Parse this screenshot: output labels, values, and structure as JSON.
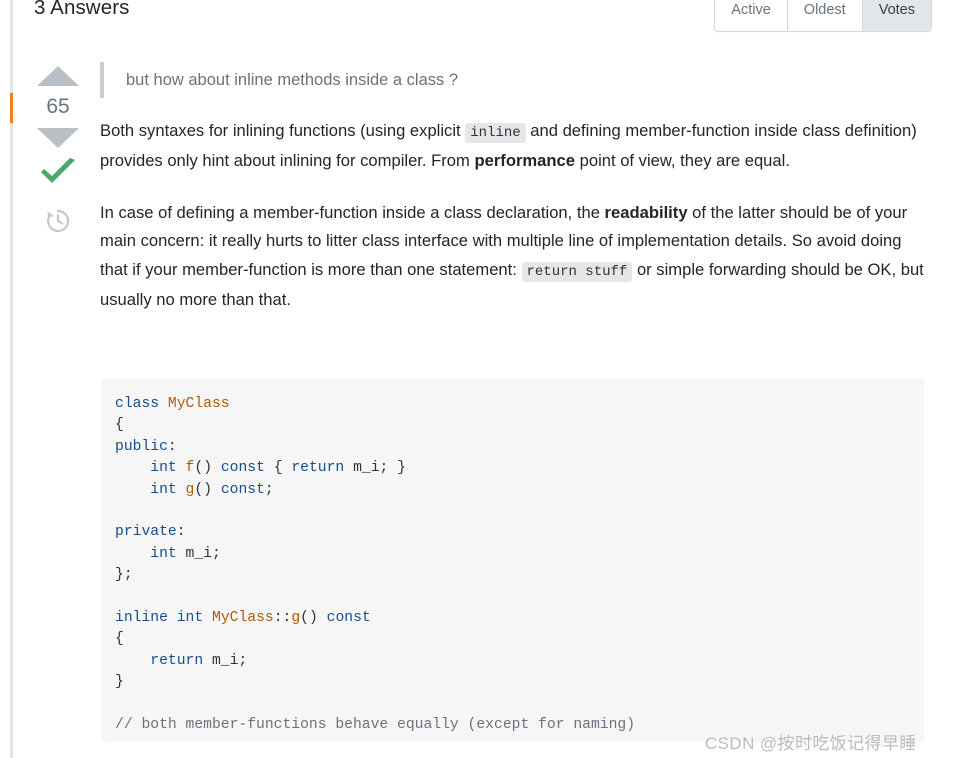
{
  "header": {
    "answers_title": "3 Answers"
  },
  "sort_tabs": [
    {
      "label": "Active",
      "selected": false
    },
    {
      "label": "Oldest",
      "selected": false
    },
    {
      "label": "Votes",
      "selected": true
    }
  ],
  "vote": {
    "count": "65",
    "up_icon": "triangle-up-icon",
    "down_icon": "triangle-down-icon",
    "accepted_icon": "checkmark-icon",
    "history_icon": "history-clock-icon",
    "arrow_color": "#b9bfc5",
    "accepted_color": "#48a868",
    "count_color": "#6a737c"
  },
  "answer": {
    "quote": "but how about inline methods inside a class ?",
    "para1": {
      "seg1": "Both syntaxes for inlining functions (using explicit ",
      "code1": "inline",
      "seg2": " and defining member-function inside class definition) provides only hint about inlining for compiler. From ",
      "bold1": "performance",
      "seg3": " point of view, they are equal."
    },
    "para2": {
      "seg1": "In case of defining a member-function inside a class declaration, the ",
      "bold1": "readability",
      "seg2": " of the latter should be of your main concern: it really hurts to litter class interface with multiple line of implementation details. So avoid doing that if your member-function is more than one statement: ",
      "code1": "return stuff",
      "seg3": " or simple forwarding should be OK, but usually no more than that."
    }
  },
  "code_block": {
    "background": "#f6f6f6",
    "lines": [
      [
        {
          "t": "class",
          "c": "kw"
        },
        {
          "t": " ",
          "c": "pl"
        },
        {
          "t": "MyClass",
          "c": "type"
        }
      ],
      [
        {
          "t": "{",
          "c": "pl"
        }
      ],
      [
        {
          "t": "public",
          "c": "kw"
        },
        {
          "t": ":",
          "c": "pl"
        }
      ],
      [
        {
          "t": "    ",
          "c": "pl"
        },
        {
          "t": "int",
          "c": "kw"
        },
        {
          "t": " ",
          "c": "pl"
        },
        {
          "t": "f",
          "c": "fn"
        },
        {
          "t": "() ",
          "c": "pl"
        },
        {
          "t": "const",
          "c": "kw"
        },
        {
          "t": " { ",
          "c": "pl"
        },
        {
          "t": "return",
          "c": "kw"
        },
        {
          "t": " m_i; }",
          "c": "pl"
        }
      ],
      [
        {
          "t": "    ",
          "c": "pl"
        },
        {
          "t": "int",
          "c": "kw"
        },
        {
          "t": " ",
          "c": "pl"
        },
        {
          "t": "g",
          "c": "fn"
        },
        {
          "t": "() ",
          "c": "pl"
        },
        {
          "t": "const",
          "c": "kw"
        },
        {
          "t": ";",
          "c": "pl"
        }
      ],
      [],
      [
        {
          "t": "private",
          "c": "kw"
        },
        {
          "t": ":",
          "c": "pl"
        }
      ],
      [
        {
          "t": "    ",
          "c": "pl"
        },
        {
          "t": "int",
          "c": "kw"
        },
        {
          "t": " m_i;",
          "c": "pl"
        }
      ],
      [
        {
          "t": "};",
          "c": "pl"
        }
      ],
      [],
      [
        {
          "t": "inline",
          "c": "kw"
        },
        {
          "t": " ",
          "c": "pl"
        },
        {
          "t": "int",
          "c": "kw"
        },
        {
          "t": " ",
          "c": "pl"
        },
        {
          "t": "MyClass",
          "c": "type"
        },
        {
          "t": "::",
          "c": "pl"
        },
        {
          "t": "g",
          "c": "fn"
        },
        {
          "t": "() ",
          "c": "pl"
        },
        {
          "t": "const",
          "c": "kw"
        }
      ],
      [
        {
          "t": "{",
          "c": "pl"
        }
      ],
      [
        {
          "t": "    ",
          "c": "pl"
        },
        {
          "t": "return",
          "c": "kw"
        },
        {
          "t": " m_i;",
          "c": "pl"
        }
      ],
      [
        {
          "t": "}",
          "c": "pl"
        }
      ],
      [],
      [
        {
          "t": "// both member-functions behave equally (except for naming)",
          "c": "cm"
        }
      ]
    ]
  },
  "watermark": {
    "text": "CSDN @按时吃饭记得早睡"
  }
}
